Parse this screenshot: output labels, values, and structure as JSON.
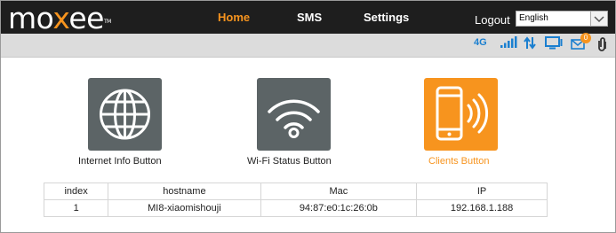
{
  "brand": {
    "logo_prefix": "mo",
    "logo_x": "x",
    "logo_suffix": "ee",
    "logo_tm": "TM",
    "accent_color": "#f7941e"
  },
  "nav": {
    "home": "Home",
    "sms": "SMS",
    "settings": "Settings",
    "active": "Home"
  },
  "header": {
    "logout": "Logout",
    "language": "English"
  },
  "status": {
    "network": "4G",
    "message_count": "0",
    "icons": [
      "signal-bars-icon",
      "data-transfer-icon",
      "monitor-icon",
      "mail-icon",
      "paperclip-icon"
    ]
  },
  "tiles": [
    {
      "label": "Internet Info Button",
      "icon": "globe-icon"
    },
    {
      "label": "Wi-Fi Status Button",
      "icon": "wifi-icon"
    },
    {
      "label": "Clients Button",
      "icon": "smartphone-icon"
    }
  ],
  "clients_table": {
    "columns": [
      "index",
      "hostname",
      "Mac",
      "IP"
    ],
    "rows": [
      [
        "1",
        "MI8-xiaomishouji",
        "94:87:e0:1c:26:0b",
        "192.168.1.188"
      ]
    ]
  }
}
